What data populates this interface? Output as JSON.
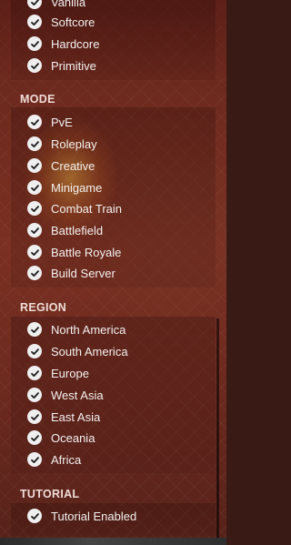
{
  "sections": {
    "top": {
      "items": [
        "Vanilla",
        "Softcore",
        "Hardcore",
        "Primitive"
      ]
    },
    "mode": {
      "header": "MODE",
      "items": [
        "PvE",
        "Roleplay",
        "Creative",
        "Minigame",
        "Combat Train",
        "Battlefield",
        "Battle Royale",
        "Build Server"
      ]
    },
    "region": {
      "header": "REGION",
      "items": [
        "North America",
        "South America",
        "Europe",
        "West Asia",
        "East Asia",
        "Oceania",
        "Africa"
      ]
    },
    "tutorial": {
      "header": "TUTORIAL",
      "items": [
        "Tutorial Enabled"
      ]
    }
  },
  "checkbox_icon": "check-icon",
  "colors": {
    "background": "#6e2a1e",
    "checkbox": "#efefef",
    "check_mark": "#1e1e1e",
    "text": "#f4f1ef"
  }
}
